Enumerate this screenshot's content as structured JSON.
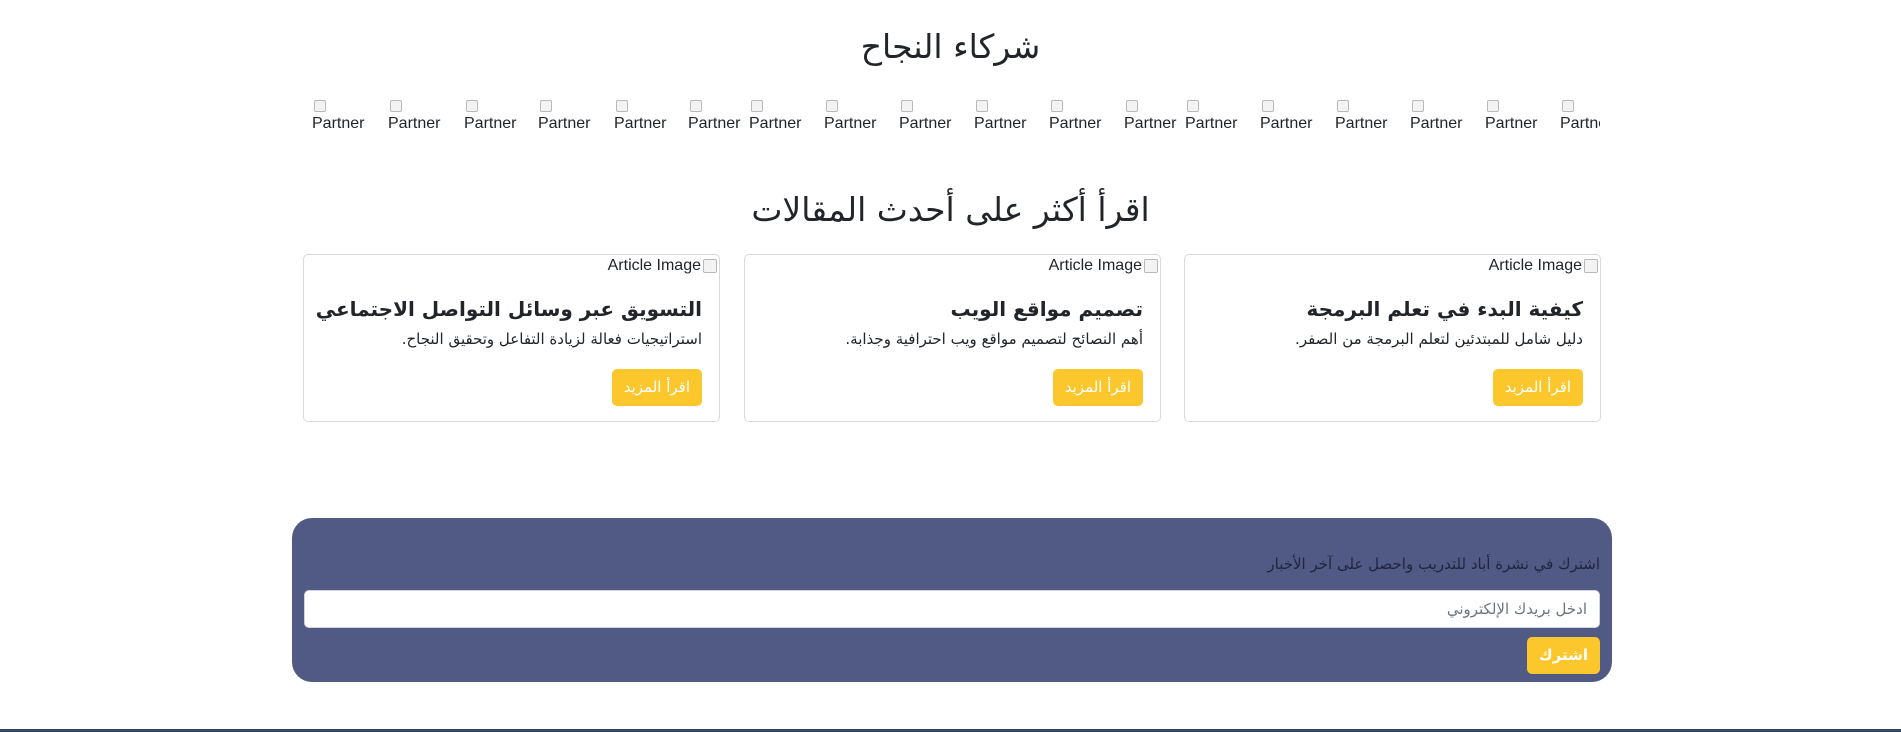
{
  "partners": {
    "title": "شركاء النجاح",
    "logos": [
      {
        "alt": "Partner"
      },
      {
        "alt": "Partner"
      },
      {
        "alt": "Partner"
      },
      {
        "alt": "Partner"
      },
      {
        "alt": "Partner"
      },
      {
        "alt": "Partner"
      },
      {
        "alt": "Partner"
      },
      {
        "alt": "Partner"
      },
      {
        "alt": "Partner"
      },
      {
        "alt": "Partner"
      },
      {
        "alt": "Partner"
      },
      {
        "alt": "Partner"
      },
      {
        "alt": "Partner"
      },
      {
        "alt": "Partner"
      },
      {
        "alt": "Partner"
      },
      {
        "alt": "Partner"
      },
      {
        "alt": "Partner"
      },
      {
        "alt": "Partner"
      }
    ]
  },
  "articles": {
    "title": "اقرأ أكثر على أحدث المقالات",
    "items": [
      {
        "image_alt": "Article Image",
        "title": "كيفية البدء في تعلم البرمجة",
        "text": "دليل شامل للمبتدئين لتعلم البرمجة من الصفر.",
        "button": "اقرأ المزيد"
      },
      {
        "image_alt": "Article Image",
        "title": "تصميم مواقع الويب",
        "text": "أهم النصائح لتصميم مواقع ويب احترافية وجذابة.",
        "button": "اقرأ المزيد"
      },
      {
        "image_alt": "Article Image",
        "title": "التسويق عبر وسائل التواصل الاجتماعي",
        "text": "استراتيجيات فعالة لزيادة التفاعل وتحقيق النجاح.",
        "button": "اقرأ المزيد"
      }
    ]
  },
  "newsletter": {
    "text": "اشترك في نشرة أباد للتدريب واحصل على آخر الأخبار",
    "email_placeholder": "ادخل بريدك الإلكتروني",
    "email_value": "",
    "button": "اشترك"
  },
  "colors": {
    "accent": "#fbc72c",
    "newsletter_bg": "#505a85",
    "footer": "#34495e"
  }
}
